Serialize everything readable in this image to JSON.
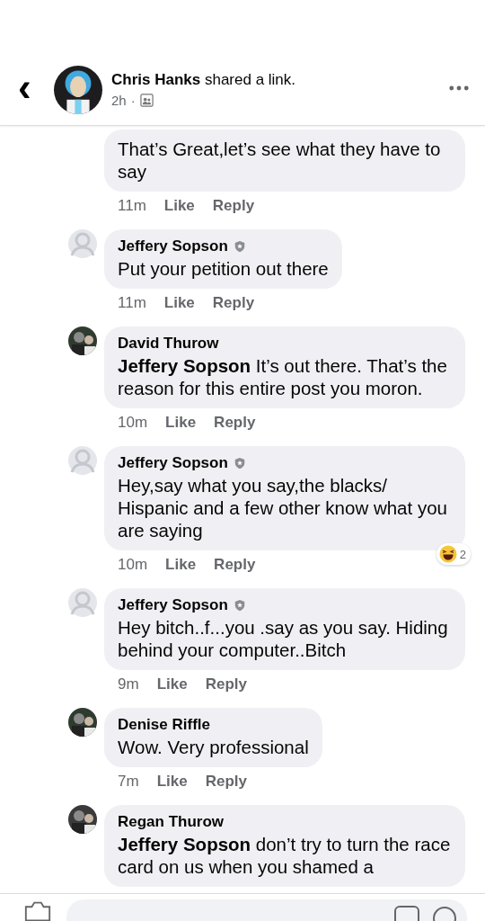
{
  "header": {
    "back": "‹",
    "author": "Chris Hanks",
    "action": "shared a link.",
    "time": "2h",
    "separator": "·"
  },
  "comments": [
    {
      "text": "That’s Great,let’s see what they have to say",
      "time": "11m",
      "like": "Like",
      "reply": "Reply"
    },
    {
      "avatar": {
        "kind": "blank"
      },
      "author": "Jeffery Sopson",
      "verified": true,
      "text": "Put your petition out there",
      "time": "11m",
      "like": "Like",
      "reply": "Reply"
    },
    {
      "author": "David Thurow",
      "verified": false,
      "text": "**Jeffery Sopson** It’s out there. That’s the reason for this entire post you moron.",
      "time": "10m",
      "like": "Like",
      "reply": "Reply"
    },
    {
      "avatar": {
        "kind": "blank"
      },
      "author": "Jeffery Sopson",
      "verified": true,
      "text": "Hey,say what you say,the blacks/ Hispanic and a few other know what you are saying",
      "time": "10m",
      "like": "Like",
      "reply": "Reply",
      "reactions": "2"
    },
    {
      "avatar": {
        "kind": "blank"
      },
      "author": "Jeffery Sopson",
      "verified": true,
      "text": "Hey bitch..f...you .say as you say. Hiding behind your computer..Bitch",
      "time": "9m",
      "like": "Like",
      "reply": "Reply"
    },
    {
      "author": "Denise Riffle",
      "verified": false,
      "text": "Wow. Very professional",
      "time": "7m",
      "like": "Like",
      "reply": "Reply"
    },
    {
      "author": "Regan Thurow",
      "verified": false,
      "text": "**Jeffery Sopson** don’t try to turn the race card on us when you shamed a"
    }
  ]
}
